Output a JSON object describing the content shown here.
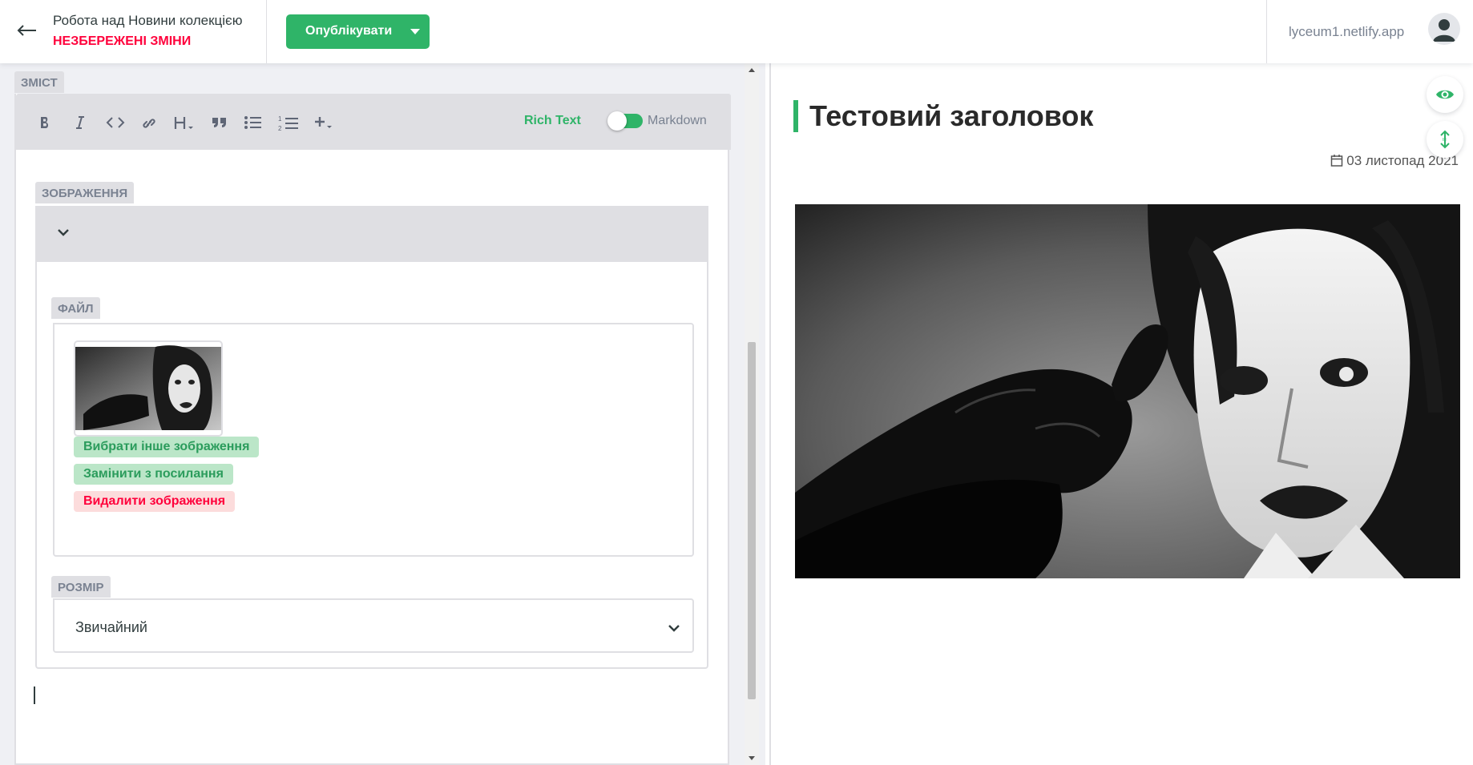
{
  "header": {
    "back_icon": "arrow-left-icon",
    "collection_title": "Робота над Новини колекцією",
    "status": "НЕЗБЕРЕЖЕНІ ЗМІНИ",
    "publish_label": "Опублікувати",
    "site_link": "lyceum1.netlify.app",
    "avatar_icon": "user-avatar-icon"
  },
  "editor": {
    "content_label": "ЗМІСТ",
    "toolbar": {
      "buttons": [
        "bold-icon",
        "italic-icon",
        "code-icon",
        "link-icon",
        "heading-icon",
        "quote-icon",
        "bulleted-list-icon",
        "numbered-list-icon",
        "add-component-icon"
      ],
      "rich_text_label": "Rich Text",
      "markdown_label": "Markdown",
      "mode": "Rich Text"
    },
    "image_widget": {
      "label": "ЗОБРАЖЕННЯ",
      "file_label": "ФАЙЛ",
      "choose_other": "Вибрати інше зображення",
      "replace_url": "Замінити з посилання",
      "remove": "Видалити зображення",
      "size_label": "РОЗМІР",
      "size_value": "Звичайний"
    }
  },
  "preview": {
    "title": "Тестовий заголовок",
    "date": "03 листопад 2021"
  },
  "colors": {
    "accent": "#2fb468",
    "danger": "#ff003b",
    "panel": "#dfdfe3",
    "editor_bg": "#eff0f4"
  }
}
